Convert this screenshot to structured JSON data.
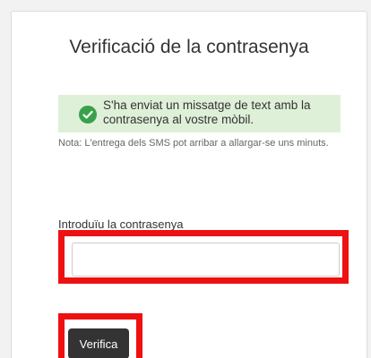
{
  "card": {
    "title": "Verificació de la contrasenya"
  },
  "alert": {
    "icon": "check-circle-icon",
    "message": "S'ha enviat un missatge de text amb la contrasenya al vostre mòbil.",
    "color": "#dff0d8"
  },
  "note": {
    "text": "Nota: L'entrega dels SMS pot arribar a allargar-se uns minuts."
  },
  "form": {
    "password_label": "Introduïu la contrasenya",
    "password_value": "",
    "password_placeholder": "",
    "submit_label": "Verifica"
  },
  "highlight_color": "#ee1111"
}
